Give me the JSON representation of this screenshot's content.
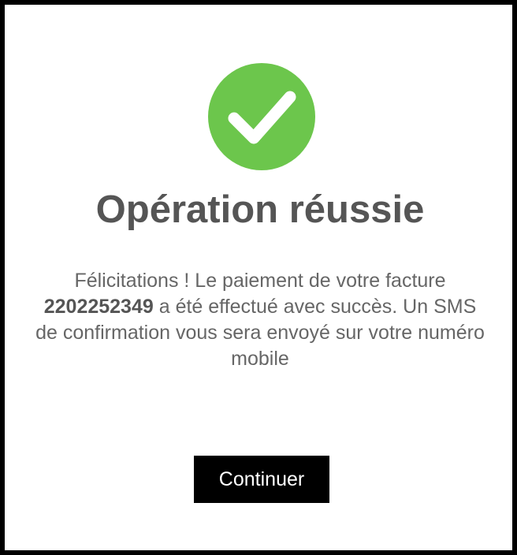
{
  "success_icon": "checkmark-circle-icon",
  "colors": {
    "success": "#6cc64c",
    "title_text": "#555555",
    "body_text": "#666666",
    "button_background": "#000000",
    "button_text": "#ffffff"
  },
  "title": "Opération réussie",
  "message": {
    "intro": "Félicitations ! Le paiement de votre facture",
    "invoice_number": "2202252349",
    "rest": "a été effectué avec succès. Un SMS de confirmation vous sera envoyé sur votre numéro mobile"
  },
  "continue_label": "Continuer"
}
